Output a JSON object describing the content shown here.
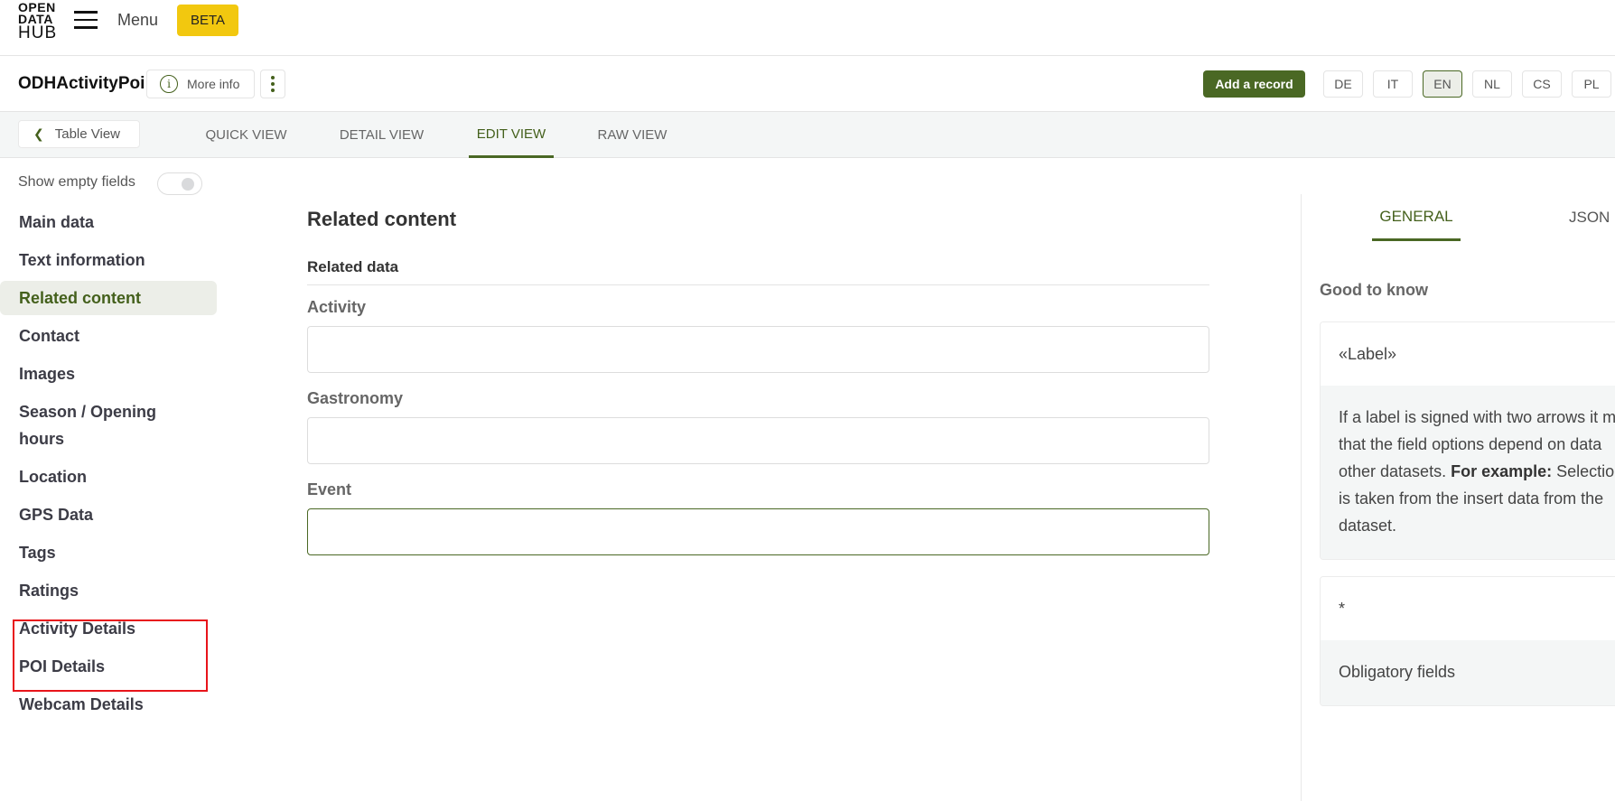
{
  "header": {
    "logo_lines": [
      "OPEN",
      "DATA",
      "HUB"
    ],
    "menu_label": "Menu",
    "beta_badge": "BETA"
  },
  "titlebar": {
    "title": "ODHActivityPoi",
    "more_info_label": "More info",
    "add_record_label": "Add a record",
    "languages": [
      {
        "code": "DE",
        "active": false
      },
      {
        "code": "IT",
        "active": false
      },
      {
        "code": "EN",
        "active": true
      },
      {
        "code": "NL",
        "active": false
      },
      {
        "code": "CS",
        "active": false
      },
      {
        "code": "PL",
        "active": false
      }
    ]
  },
  "viewbar": {
    "back_label": "Table View",
    "tabs": [
      {
        "label": "QUICK VIEW",
        "active": false
      },
      {
        "label": "DETAIL VIEW",
        "active": false
      },
      {
        "label": "EDIT VIEW",
        "active": true
      },
      {
        "label": "RAW VIEW",
        "active": false
      }
    ]
  },
  "options": {
    "show_empty_fields_label": "Show empty fields",
    "show_empty_fields_on": false
  },
  "sidebar": {
    "items": [
      {
        "label": "Main data",
        "active": false
      },
      {
        "label": "Text information",
        "active": false
      },
      {
        "label": "Related content",
        "active": true
      },
      {
        "label": "Contact",
        "active": false
      },
      {
        "label": "Images",
        "active": false
      },
      {
        "label": "Season / Opening hours",
        "active": false
      },
      {
        "label": "Location",
        "active": false
      },
      {
        "label": "GPS Data",
        "active": false
      },
      {
        "label": "Tags",
        "active": false
      },
      {
        "label": "Ratings",
        "active": false
      },
      {
        "label": "Activity Details",
        "active": false
      },
      {
        "label": "POI Details",
        "active": false
      },
      {
        "label": "Webcam Details",
        "active": false
      }
    ]
  },
  "main": {
    "title": "Related content",
    "section_title": "Related data",
    "fields": [
      {
        "label": "Activity",
        "value": "",
        "focused": false
      },
      {
        "label": "Gastronomy",
        "value": "",
        "focused": false
      },
      {
        "label": "Event",
        "value": "",
        "focused": true
      }
    ]
  },
  "right_panel": {
    "tabs": [
      {
        "label": "GENERAL",
        "active": true
      },
      {
        "label": "JSON",
        "active": false
      }
    ],
    "heading": "Good to know",
    "cards": [
      {
        "title": "«Label»",
        "body_lines": [
          "If a label is signed with two arrows it m",
          "that the field options depend on data",
          "other datasets.",
          "For example:",
          " Selectio",
          "is taken from the insert data from the",
          "dataset."
        ]
      },
      {
        "title": "*",
        "body": "Obligatory fields"
      }
    ]
  },
  "colors": {
    "accent": "#4a6824",
    "beta": "#f2c80f",
    "highlight_box": "#e8141a",
    "active_bg": "#eceee8",
    "panel_bg": "#f4f6f6"
  }
}
